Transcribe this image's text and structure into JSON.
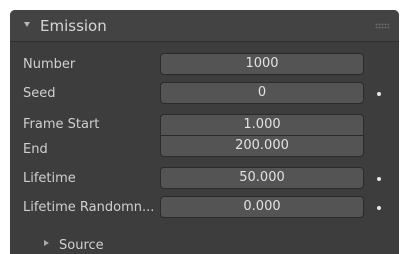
{
  "panel": {
    "title": "Emission",
    "grip_icon": "drag-grip-icon",
    "header_icon": "expand-down-arrow-icon"
  },
  "fields": {
    "number": {
      "label": "Number",
      "value": "1000"
    },
    "seed": {
      "label": "Seed",
      "value": "0"
    },
    "frame_start": {
      "label": "Frame Start",
      "value": "1.000"
    },
    "end": {
      "label": "End",
      "value": "200.000"
    },
    "lifetime": {
      "label": "Lifetime",
      "value": "50.000"
    },
    "lifetime_random": {
      "label": "Lifetime Randomn...",
      "value": "0.000"
    }
  },
  "subpanel": {
    "label": "Source",
    "icon": "collapsed-right-arrow-icon"
  },
  "colors": {
    "panel_bg": "#3d3d3d",
    "header_bg": "#434343",
    "field_bg": "#545454",
    "text": "#d0d0d0"
  }
}
